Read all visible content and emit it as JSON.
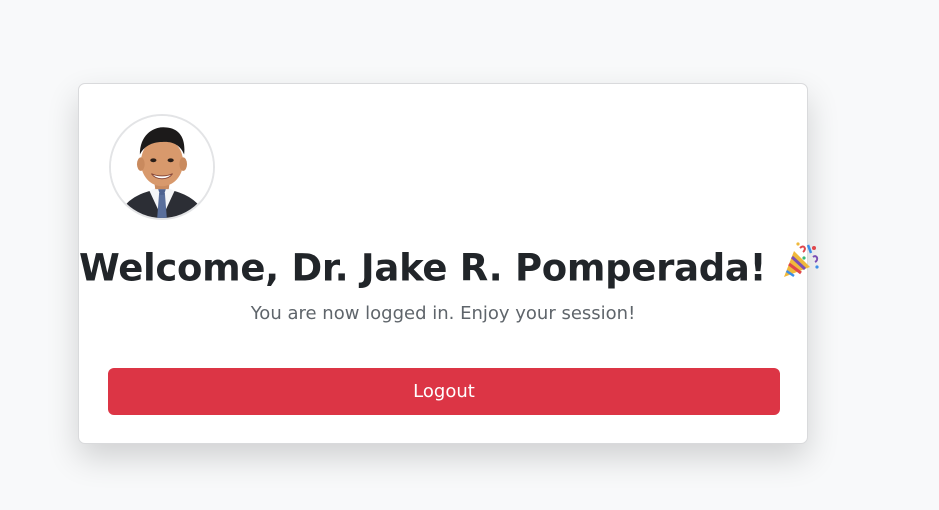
{
  "card": {
    "avatar_alt": "profile photo",
    "welcome_title": "Welcome, Dr. Jake R. Pomperada!",
    "title_icon": "party-popper-icon",
    "subtitle": "You are now logged in. Enjoy your session!",
    "logout_label": "Logout"
  },
  "colors": {
    "page_background": "#f8f9fa",
    "card_background": "#ffffff",
    "title_text": "#212529",
    "subtitle_text": "#5f656b",
    "logout_button": "#dc3545",
    "logout_text": "#ffffff"
  }
}
